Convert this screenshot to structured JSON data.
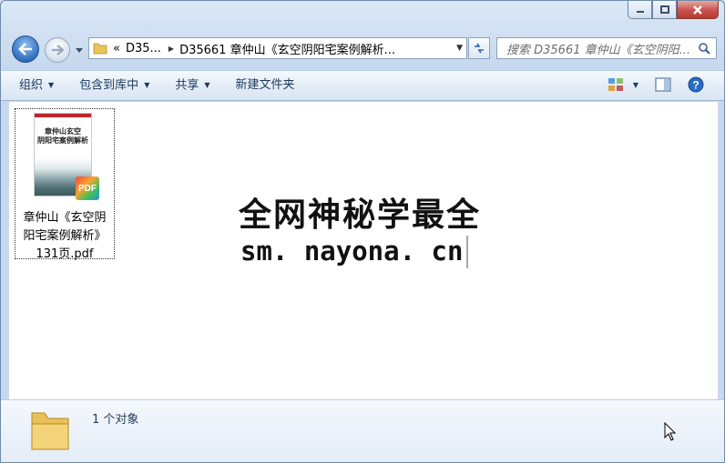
{
  "window": {
    "caption": {
      "minimize": "minimize",
      "maximize": "maximize",
      "close": "close"
    }
  },
  "nav": {
    "breadcrumb": {
      "overflow": "«",
      "segment_1": "D35...",
      "segment_2": "D35661 章仲山《玄空阴阳宅案例解析..."
    },
    "search_placeholder": "搜索 D35661 章仲山《玄空阴阳..."
  },
  "toolbar": {
    "organize": "组织",
    "include_in_library": "包含到库中",
    "share": "共享",
    "new_folder": "新建文件夹"
  },
  "file": {
    "name": "章仲山《玄空阴阳宅案例解析》131页.pdf",
    "name_line1": "章仲山《玄空阴",
    "name_line2": "阳宅案例解析》",
    "name_line3": "131页.pdf",
    "thumbnail_title_1": "章仲山玄空",
    "thumbnail_title_2": "阴阳宅案例解析",
    "badge": "PDF"
  },
  "watermark": {
    "line1": "全网神秘学最全",
    "line2": "sm. nayona. cn"
  },
  "details": {
    "count": "1 个对象"
  }
}
